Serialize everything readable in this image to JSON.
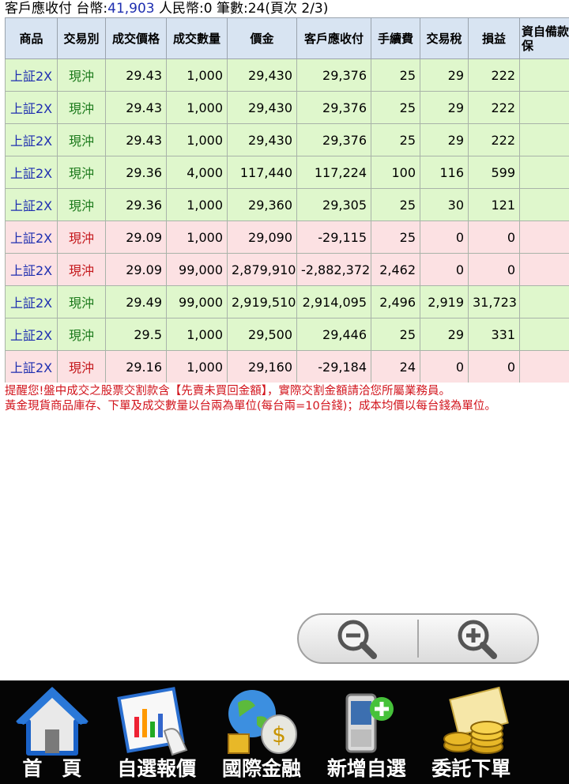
{
  "summary": {
    "prefix": "客戶應收付 台幣:",
    "twd": "41,903",
    "rmb": " 人民幣:0",
    "count": " 筆數:24",
    "page": "(頁次 2/3)"
  },
  "table": {
    "headers": [
      "商品",
      "交易別",
      "成交價格",
      "成交數量",
      "價金",
      "客戶應收付",
      "手續費",
      "交易稅",
      "損益",
      "資自備款/券擔保"
    ],
    "rows": [
      {
        "product": "上証2X",
        "side": "現沖",
        "price": "29.43",
        "qty": "1,000",
        "amount": "29,430",
        "receivable": "29,376",
        "fee": "25",
        "tax": "29",
        "pnl": "222",
        "deposit": "",
        "tone": "green"
      },
      {
        "product": "上証2X",
        "side": "現沖",
        "price": "29.43",
        "qty": "1,000",
        "amount": "29,430",
        "receivable": "29,376",
        "fee": "25",
        "tax": "29",
        "pnl": "222",
        "deposit": "",
        "tone": "green"
      },
      {
        "product": "上証2X",
        "side": "現沖",
        "price": "29.43",
        "qty": "1,000",
        "amount": "29,430",
        "receivable": "29,376",
        "fee": "25",
        "tax": "29",
        "pnl": "222",
        "deposit": "",
        "tone": "green"
      },
      {
        "product": "上証2X",
        "side": "現沖",
        "price": "29.36",
        "qty": "4,000",
        "amount": "117,440",
        "receivable": "117,224",
        "fee": "100",
        "tax": "116",
        "pnl": "599",
        "deposit": "",
        "tone": "green"
      },
      {
        "product": "上証2X",
        "side": "現沖",
        "price": "29.36",
        "qty": "1,000",
        "amount": "29,360",
        "receivable": "29,305",
        "fee": "25",
        "tax": "30",
        "pnl": "121",
        "deposit": "",
        "tone": "green"
      },
      {
        "product": "上証2X",
        "side": "現沖",
        "price": "29.09",
        "qty": "1,000",
        "amount": "29,090",
        "receivable": "-29,115",
        "fee": "25",
        "tax": "0",
        "pnl": "0",
        "deposit": "",
        "tone": "pink"
      },
      {
        "product": "上証2X",
        "side": "現沖",
        "price": "29.09",
        "qty": "99,000",
        "amount": "2,879,910",
        "receivable": "-2,882,372",
        "fee": "2,462",
        "tax": "0",
        "pnl": "0",
        "deposit": "",
        "tone": "pink"
      },
      {
        "product": "上証2X",
        "side": "現沖",
        "price": "29.49",
        "qty": "99,000",
        "amount": "2,919,510",
        "receivable": "2,914,095",
        "fee": "2,496",
        "tax": "2,919",
        "pnl": "31,723",
        "deposit": "",
        "tone": "green"
      },
      {
        "product": "上証2X",
        "side": "現沖",
        "price": "29.5",
        "qty": "1,000",
        "amount": "29,500",
        "receivable": "29,446",
        "fee": "25",
        "tax": "29",
        "pnl": "331",
        "deposit": "",
        "tone": "green"
      },
      {
        "product": "上証2X",
        "side": "現沖",
        "price": "29.16",
        "qty": "1,000",
        "amount": "29,160",
        "receivable": "-29,184",
        "fee": "24",
        "tax": "0",
        "pnl": "0",
        "deposit": "",
        "tone": "pink"
      }
    ]
  },
  "notes": [
    "提醒您!盤中成交之股票交割款含【先賣未買回金額】，實際交割金額請洽您所屬業務員。",
    "黃金現貨商品庫存、下單及成交數量以台兩為單位(每台兩=10台錢)；成本均價以每台錢為單位。"
  ],
  "zoom": {
    "out_icon": "zoom-out-icon",
    "in_icon": "zoom-in-icon"
  },
  "nav": [
    {
      "label": "首　頁",
      "icon": "home-icon"
    },
    {
      "label": "自選報價",
      "icon": "quote-chart-icon"
    },
    {
      "label": "國際金融",
      "icon": "globe-money-icon"
    },
    {
      "label": "新增自選",
      "icon": "phone-add-icon"
    },
    {
      "label": "委託下單",
      "icon": "gold-coins-icon"
    }
  ],
  "colors": {
    "accent_blue": "#1f2fb0",
    "green_row": "#dff7cc",
    "pink_row": "#fce1e3",
    "note_red": "#d2141c"
  }
}
